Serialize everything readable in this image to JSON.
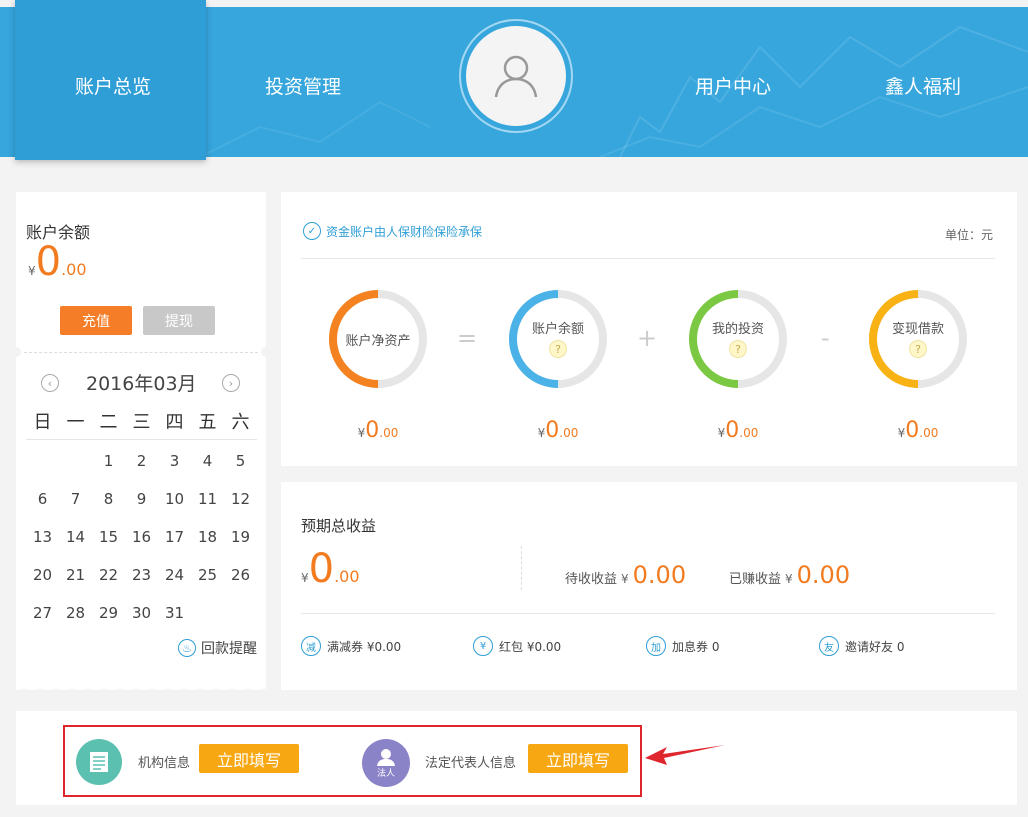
{
  "nav": {
    "items": [
      "账户总览",
      "投资管理",
      "用户中心",
      "鑫人福利"
    ]
  },
  "balance": {
    "title": "账户余额",
    "yen": "¥",
    "int": "0",
    "dec": ".00",
    "recharge_label": "充值",
    "withdraw_label": "提现"
  },
  "calendar": {
    "month": "2016年03月",
    "weekdays": [
      "日",
      "一",
      "二",
      "三",
      "四",
      "五",
      "六"
    ],
    "days": [
      "",
      "",
      "1",
      "2",
      "3",
      "4",
      "5",
      "6",
      "7",
      "8",
      "9",
      "10",
      "11",
      "12",
      "13",
      "14",
      "15",
      "16",
      "17",
      "18",
      "19",
      "20",
      "21",
      "22",
      "23",
      "24",
      "25",
      "26",
      "27",
      "28",
      "29",
      "30",
      "31"
    ],
    "remind_label": "回款提醒"
  },
  "assets": {
    "insure_text": "资金账户由人保财险保险承保",
    "unit_text": "单位：元",
    "items": [
      {
        "label": "账户净资产",
        "value_int": "0",
        "value_dec": ".00",
        "color": "#f58220",
        "help": false
      },
      {
        "label": "账户余额",
        "value_int": "0",
        "value_dec": ".00",
        "color": "#4bb2e8",
        "help": true
      },
      {
        "label": "我的投资",
        "value_int": "0",
        "value_dec": ".00",
        "color": "#7bc843",
        "help": true
      },
      {
        "label": "变现借款",
        "value_int": "0",
        "value_dec": ".00",
        "color": "#f8b214",
        "help": true
      }
    ],
    "operators": [
      "=",
      "+",
      "-"
    ],
    "yen": "¥",
    "help_mark": "?"
  },
  "income": {
    "title": "预期总收益",
    "yen": "¥",
    "total_int": "0",
    "total_dec": ".00",
    "pending_label": "待收收益",
    "pending_value": "0.00",
    "earned_label": "已赚收益",
    "earned_value": "0.00",
    "bonuses": [
      {
        "icon": "减",
        "text": "满减券 ¥0.00"
      },
      {
        "icon": "¥",
        "text": "红包 ¥0.00"
      },
      {
        "icon": "加",
        "text": "加息券 0"
      },
      {
        "icon": "友",
        "text": "邀请好友 0"
      }
    ]
  },
  "profile": {
    "org_label": "机构信息",
    "legal_label": "法定代表人信息",
    "legal_badge": "法人",
    "fill_label": "立即填写"
  },
  "colors": {
    "header": "#36a6dd",
    "accent_orange": "#f27b20",
    "highlight_red": "#e0262d"
  }
}
